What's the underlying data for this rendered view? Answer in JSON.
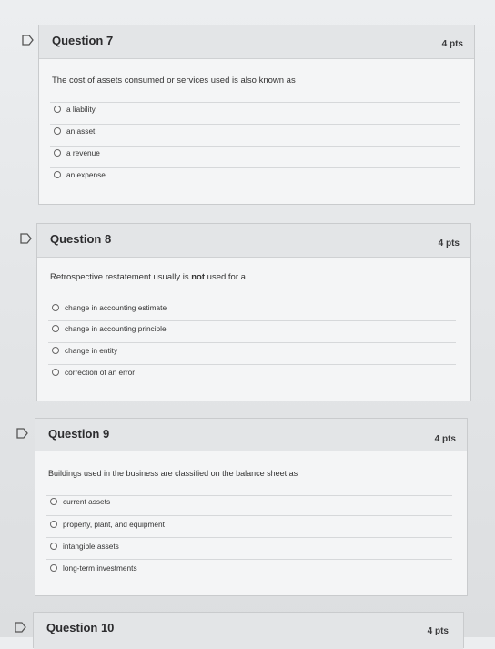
{
  "questions": [
    {
      "title": "Question 7",
      "points": "4 pts",
      "text": "The cost of assets consumed or services used is also known as",
      "options": [
        "a liability",
        "an asset",
        "a revenue",
        "an expense"
      ]
    },
    {
      "title": "Question 8",
      "points": "4 pts",
      "text_before": "Retrospective restatement usually is ",
      "text_bold": "not",
      "text_after": " used for a",
      "options": [
        "change in accounting estimate",
        "change in accounting principle",
        "change in entity",
        "correction of an error"
      ]
    },
    {
      "title": "Question 9",
      "points": "4 pts",
      "text": "Buildings used in the business are classified on the balance sheet as",
      "options": [
        "current assets",
        "property, plant, and equipment",
        "intangible assets",
        "long-term investments"
      ]
    },
    {
      "title": "Question 10",
      "points": "4 pts"
    }
  ]
}
